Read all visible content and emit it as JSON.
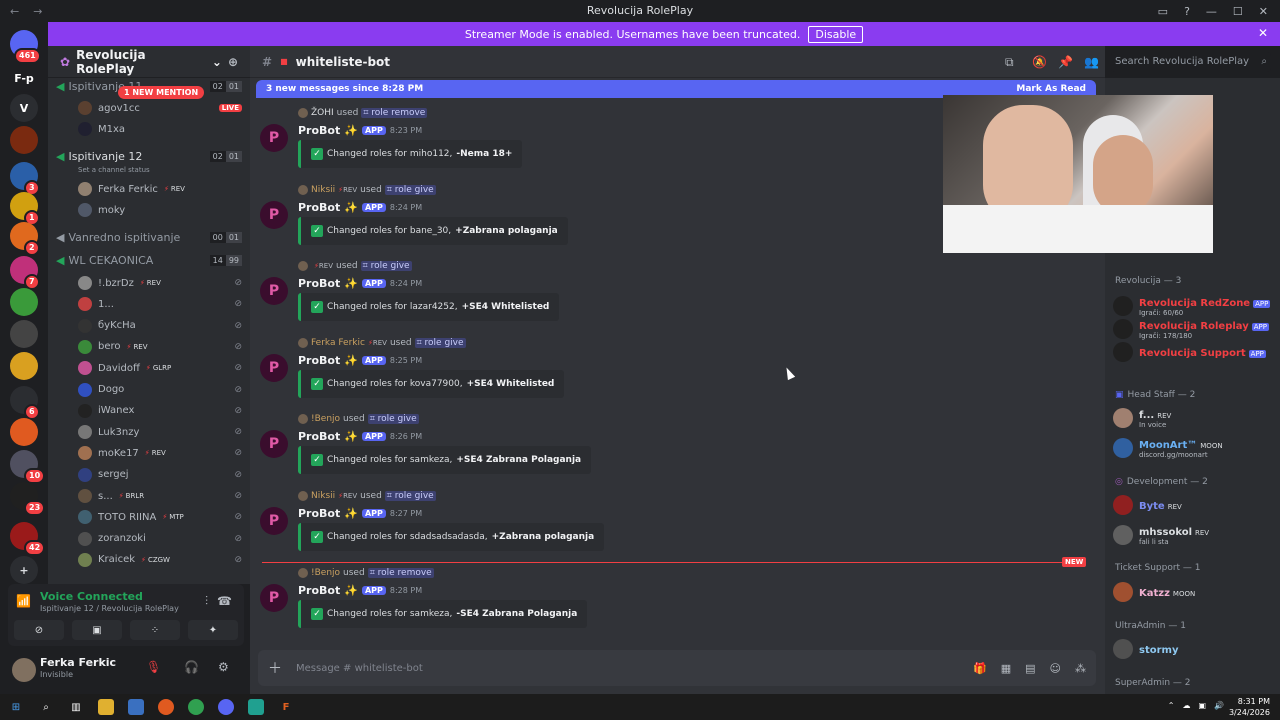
{
  "window": {
    "title": "Revolucija RolePlay"
  },
  "banner": {
    "text": "Streamer Mode is enabled. Usernames have been truncated.",
    "disable_label": "Disable"
  },
  "servers": [
    {
      "label": "",
      "badge": "461",
      "color": "#5865f2"
    },
    {
      "label": "F-p",
      "badge": "",
      "color": "#1e1f22"
    },
    {
      "label": "V",
      "badge": "",
      "color": "#2b2d31"
    },
    {
      "label": "",
      "badge": "",
      "color": "#7a2a10"
    },
    {
      "label": "",
      "badge": "3",
      "color": "#2a5fa8"
    },
    {
      "label": "",
      "badge": "1",
      "color": "#d1a010"
    },
    {
      "label": "",
      "badge": "2",
      "color": "#e0691e"
    },
    {
      "label": "",
      "badge": "7",
      "color": "#c0307a"
    },
    {
      "label": "",
      "badge": "",
      "color": "#3a9a3a"
    },
    {
      "label": "",
      "badge": "",
      "color": "#444"
    },
    {
      "label": "",
      "badge": "",
      "color": "#d9a020"
    },
    {
      "label": "",
      "badge": "6",
      "color": "#2b2d31"
    },
    {
      "label": "",
      "badge": "",
      "color": "#e05a20"
    },
    {
      "label": "",
      "badge": "10",
      "color": "#505060"
    },
    {
      "label": "",
      "badge": "23",
      "color": "#202020"
    },
    {
      "label": "",
      "badge": "42",
      "color": "#9a1a1a"
    }
  ],
  "guild": {
    "name": "Revolucija RolePlay"
  },
  "channels": {
    "mention_pill": "1 NEW MENTION",
    "live": "LIVE",
    "voice": [
      {
        "name": "Ispitivanje 11",
        "c1": "02",
        "c2": "01"
      },
      {
        "name": "Ispitivanje 12",
        "c1": "02",
        "c2": "01",
        "status": "Set a channel status"
      },
      {
        "name": "Vanredno ispitivanje",
        "c1": "00",
        "c2": "01"
      },
      {
        "name": "WL CEKAONICA",
        "c1": "14",
        "c2": "99"
      }
    ],
    "users_top": [
      "agov1cc",
      "M1xa"
    ],
    "users_12": [
      {
        "name": "Ferka Ferkic",
        "tag": "REV"
      },
      {
        "name": "moky",
        "tag": ""
      }
    ],
    "users_wl": [
      {
        "name": "!.bzrDz",
        "tag": "REV",
        "color": "#888"
      },
      {
        "name": "1...",
        "tag": "",
        "color": "#c04040"
      },
      {
        "name": "бyKcHa",
        "tag": "",
        "color": "#333"
      },
      {
        "name": "bero",
        "tag": "REV",
        "color": "#3a8a3a"
      },
      {
        "name": "Davidoff",
        "tag": "GLRP",
        "color": "#c05090"
      },
      {
        "name": "Dogo",
        "tag": "",
        "color": "#3050c0"
      },
      {
        "name": "iWanex",
        "tag": "",
        "color": "#222"
      },
      {
        "name": "Luk3nzy",
        "tag": "",
        "color": "#777"
      },
      {
        "name": "moKe17",
        "tag": "REV",
        "color": "#a07050"
      },
      {
        "name": "sergej",
        "tag": "",
        "color": "#304080"
      },
      {
        "name": "s...",
        "tag": "BRLR",
        "color": "#605040"
      },
      {
        "name": "TOTO RIINA",
        "tag": "MTP",
        "color": "#406070"
      },
      {
        "name": "zoranzoki",
        "tag": "",
        "color": "#505050"
      },
      {
        "name": "Kraicek",
        "tag": "CZGW",
        "color": "#708050"
      }
    ]
  },
  "voice_panel": {
    "title": "Voice Connected",
    "subtitle": "Ispitivanje 12 / Revolucija RolePlay"
  },
  "user_panel": {
    "name": "Ferka Ferkic",
    "status": "Invisible"
  },
  "chat": {
    "channel": "whiteliste-bot",
    "search_placeholder": "Search Revolucija RolePlay",
    "new_bar": "3 new messages since 8:28 PM",
    "mark_read": "Mark As Read",
    "new_tag": "NEW",
    "input_placeholder": "Message # whiteliste-bot",
    "messages": [
      {
        "by": "ŽOHI",
        "tag": "",
        "cmd": "role remove",
        "time": "8:23 PM",
        "text": "Changed roles for miho112,",
        "bold": "-Nema 18+"
      },
      {
        "by": "Niksii",
        "tag": "REV",
        "cmd": "role give",
        "time": "8:24 PM",
        "text": "Changed roles for bane_30,",
        "bold": "+Zabrana polaganja"
      },
      {
        "by": "",
        "tag": "REV",
        "cmd": "role give",
        "time": "8:24 PM",
        "text": "Changed roles for lazar4252,",
        "bold": "+SE4 Whitelisted"
      },
      {
        "by": "Ferka Ferkic",
        "tag": "REV",
        "cmd": "role give",
        "time": "8:25 PM",
        "text": "Changed roles for kova77900,",
        "bold": "+SE4 Whitelisted"
      },
      {
        "by": "!Benjo",
        "tag": "",
        "cmd": "role give",
        "time": "8:26 PM",
        "text": "Changed roles for samkeza,",
        "bold": "+SE4 Zabrana Polaganja"
      },
      {
        "by": "Niksii",
        "tag": "REV",
        "cmd": "role give",
        "time": "8:27 PM",
        "text": "Changed roles for sdadsadsadasda,",
        "bold": "+Zabrana polaganja"
      },
      {
        "by": "!Benjo",
        "tag": "",
        "cmd": "role remove",
        "time": "8:28 PM",
        "text": "Changed roles for samkeza,",
        "bold": "-SE4 Zabrana Polaganja"
      }
    ],
    "bot_name": "ProBot",
    "app_tag": "APP",
    "used": "used"
  },
  "members": {
    "cat1": "Revolucija — 3",
    "rev": [
      {
        "name": "Revolucija RedZone",
        "status": "Igrači: 60/60"
      },
      {
        "name": "Revolucija Roleplay",
        "status": "Igrači: 178/180"
      },
      {
        "name": "Revolucija Support",
        "status": ""
      }
    ],
    "cat2": "Head Staff — 2",
    "head": [
      {
        "name": "f...",
        "tag": "REV",
        "status": "In voice",
        "color": "#dbdee1"
      },
      {
        "name": "MoonArt™",
        "tag": "MOON",
        "status": "discord.gg/moonart",
        "color": "#6ab0f3"
      }
    ],
    "cat3": "Development — 2",
    "dev": [
      {
        "name": "Byte",
        "tag": "REV",
        "status": "",
        "color": "#7b8cf0"
      },
      {
        "name": "mhssokol",
        "tag": "REV",
        "status": "fali li sta",
        "color": "#dbdee1"
      }
    ],
    "cat4": "Ticket Support — 1",
    "ticket": [
      {
        "name": "Katzz",
        "tag": "MOON",
        "color": "#f0b0d0"
      }
    ],
    "cat5": "UltraAdmin — 1",
    "ultra": [
      {
        "name": "stormy",
        "color": "#8ec8f0"
      }
    ],
    "cat6": "SuperAdmin — 2"
  },
  "taskbar": {
    "time": "8:31 PM",
    "date": "3/24/2026"
  }
}
